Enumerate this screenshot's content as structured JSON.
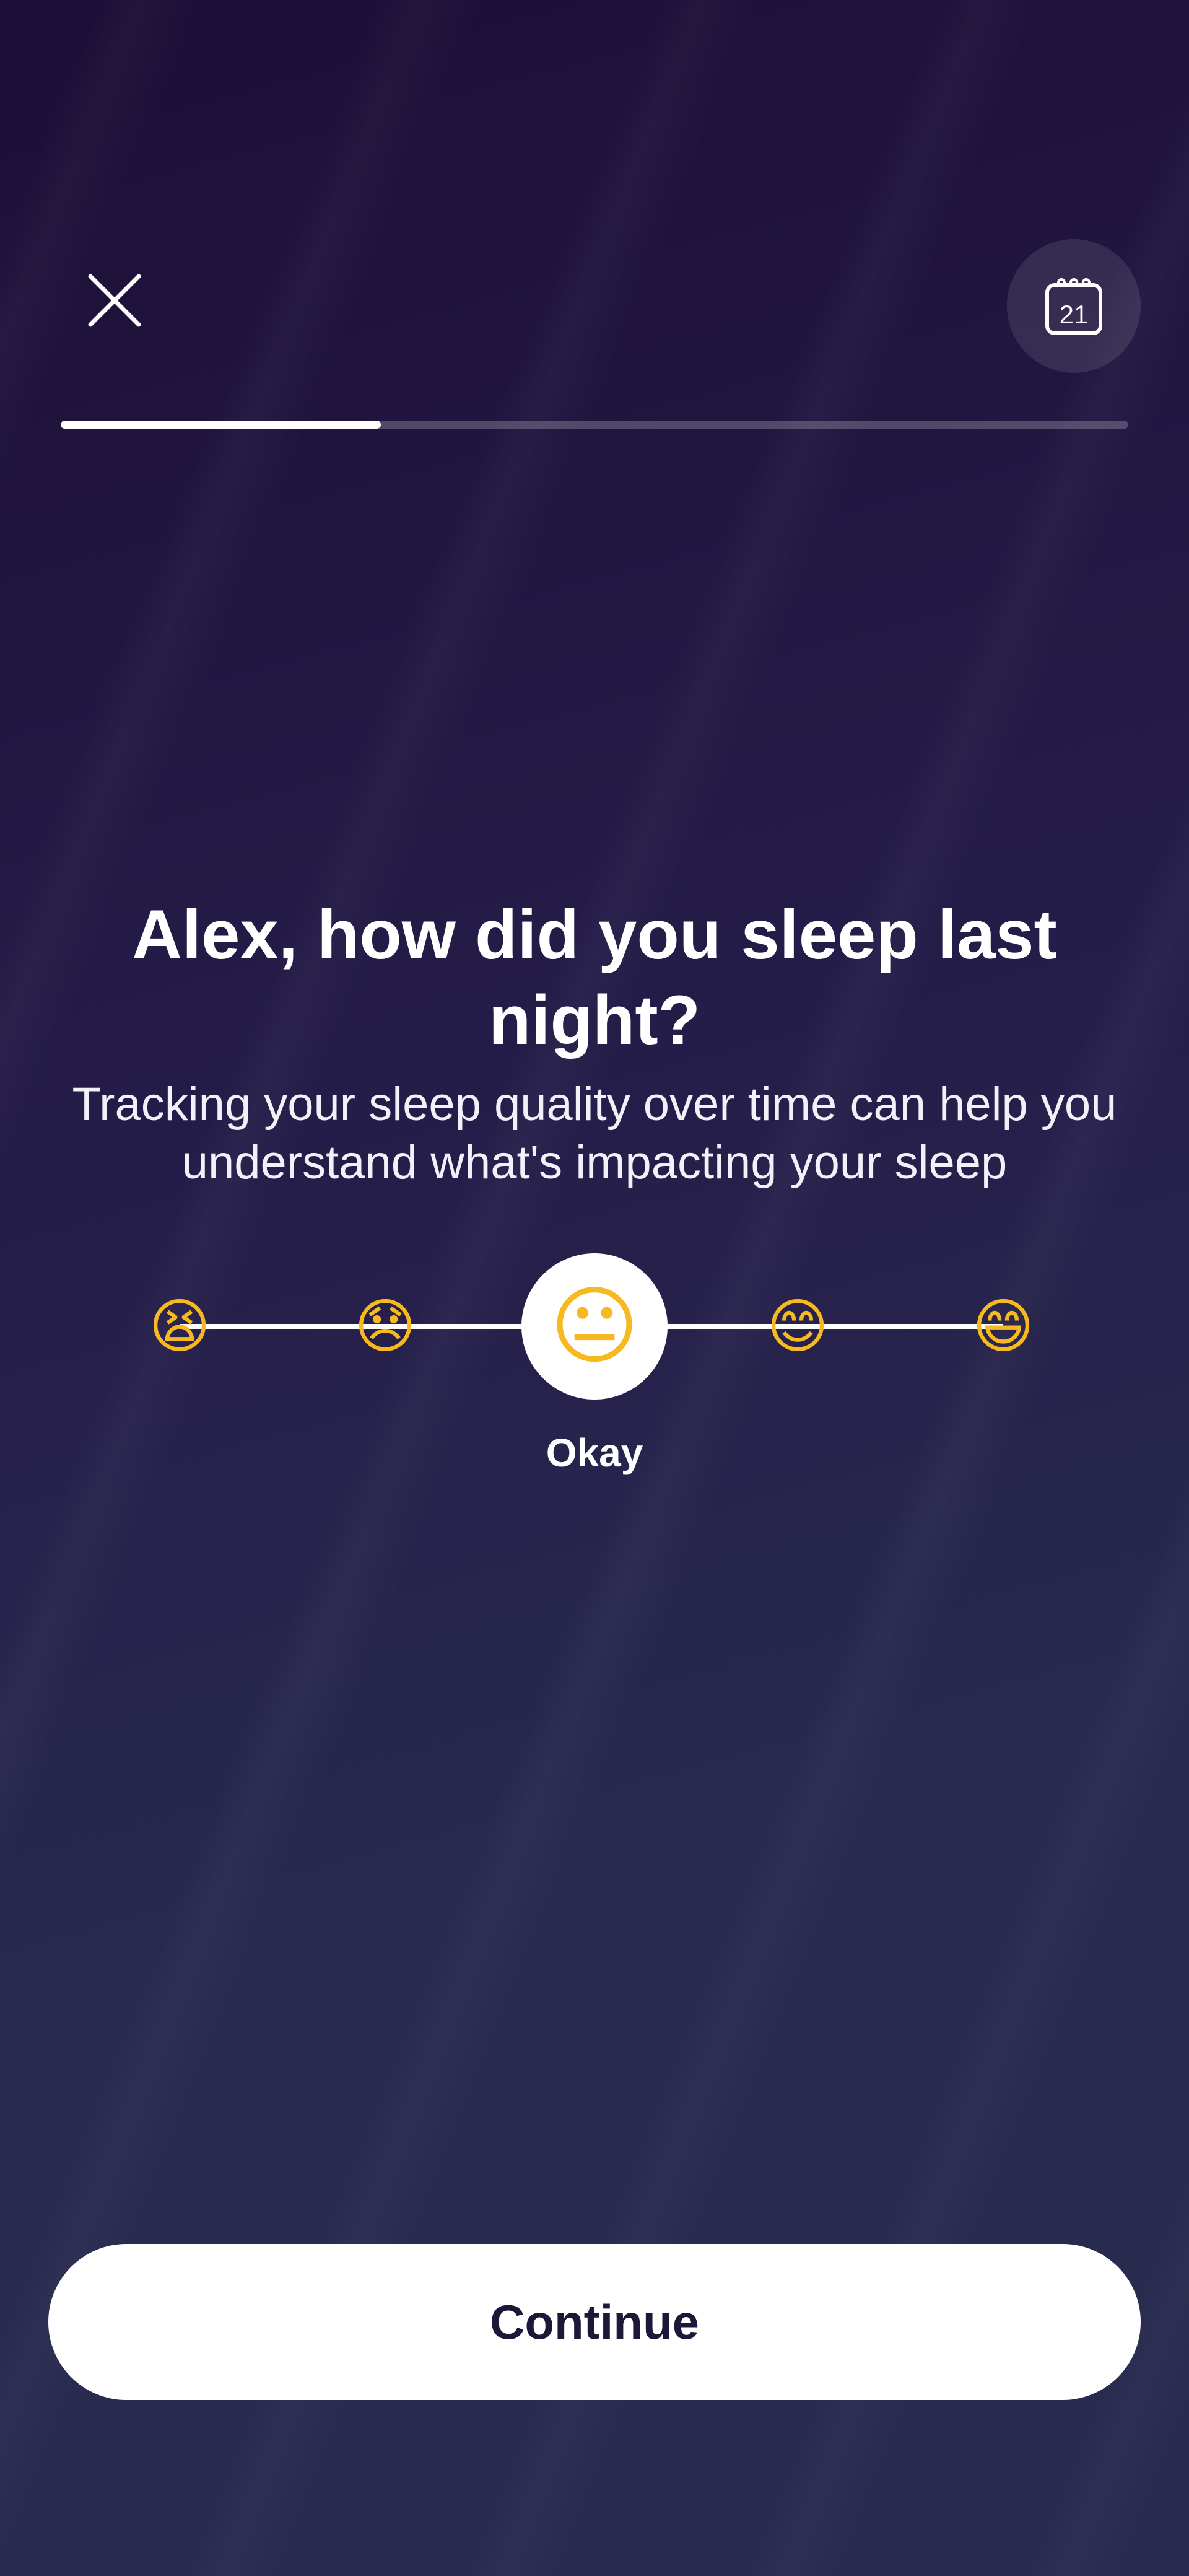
{
  "header": {
    "close_icon": "close-icon",
    "calendar_icon": "calendar-icon",
    "calendar_day": "21"
  },
  "progress": {
    "fraction": 0.3
  },
  "question": {
    "title": "Alex, how did you sleep last night?",
    "subtitle": "Tracking your sleep quality over time can help you understand what's impacting your sleep"
  },
  "rating": {
    "options": [
      {
        "emoji": "😫",
        "icon": "tired-face-icon"
      },
      {
        "emoji": "😞",
        "icon": "disappointed-face-icon"
      },
      {
        "emoji": "😐",
        "icon": "neutral-face-icon"
      },
      {
        "emoji": "😊",
        "icon": "smiling-face-icon"
      },
      {
        "emoji": "😄",
        "icon": "grinning-face-icon"
      }
    ],
    "selected_index": 2,
    "selected_label": "Okay"
  },
  "footer": {
    "continue_label": "Continue"
  }
}
